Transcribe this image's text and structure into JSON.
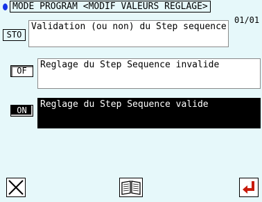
{
  "header": {
    "title": "MODE PROGRAM <MODIF VALEURS REGLAGE>"
  },
  "page_indicator": "01/01",
  "question": {
    "tag": "STO",
    "text": "Validation (ou non) du Step sequence"
  },
  "options": [
    {
      "label": "OF",
      "text": "Reglage du Step Sequence invalide",
      "selected": false
    },
    {
      "label": "ON",
      "text": "Reglage du Step Sequence valide",
      "selected": true
    }
  ],
  "footer": {
    "cancel_icon": "close-icon",
    "manual_icon": "book-icon",
    "confirm_icon": "enter-arrow-icon"
  },
  "colors": {
    "background": "#e6f8fa",
    "accent_dot": "#1536e8",
    "confirm_arrow": "#c81a0a"
  }
}
